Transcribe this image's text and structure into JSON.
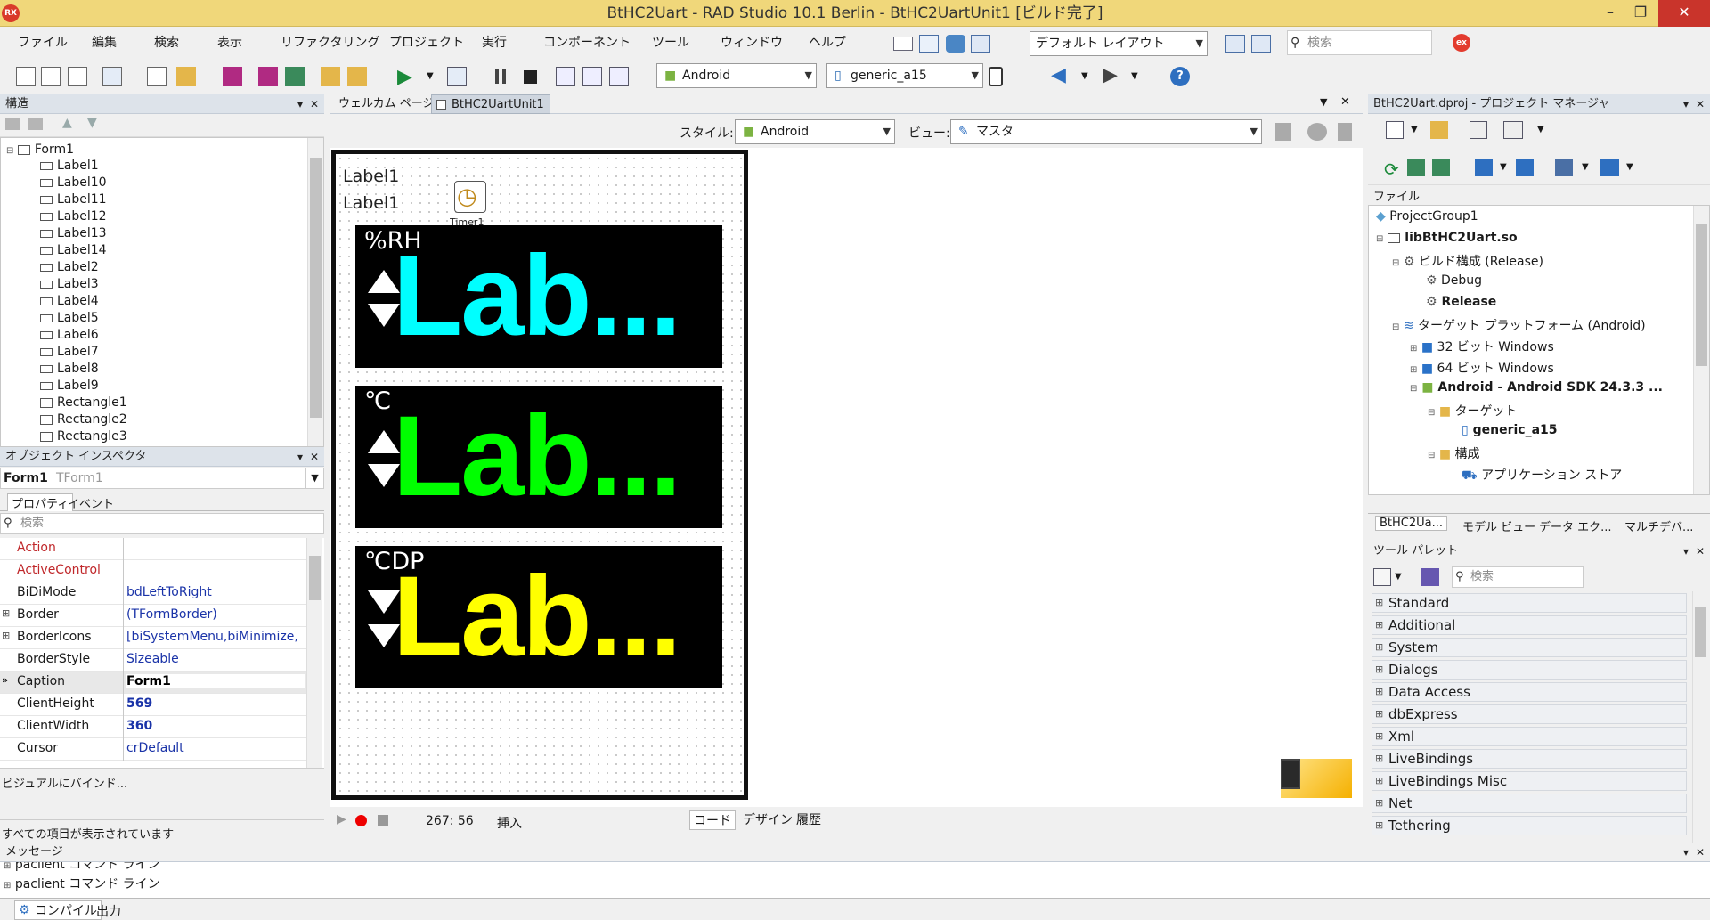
{
  "titlebar": {
    "logo": "RX",
    "title": "BtHC2Uart - RAD Studio 10.1 Berlin - BtHC2UartUnit1 [ビルド完了]"
  },
  "menu": [
    "ファイル",
    "編集",
    "検索",
    "表示",
    "リファクタリング",
    "プロジェクト",
    "実行",
    "コンポーネント",
    "ツール",
    "ウィンドウ",
    "ヘルプ"
  ],
  "toolbar": {
    "layout_combo": "デフォルト レイアウト",
    "search_placeholder": "検索",
    "platform": "Android",
    "device": "generic_a15"
  },
  "structure": {
    "title": "構造",
    "root": "Form1",
    "items": [
      "Label1",
      "Label10",
      "Label11",
      "Label12",
      "Label13",
      "Label14",
      "Label2",
      "Label3",
      "Label4",
      "Label5",
      "Label6",
      "Label7",
      "Label8",
      "Label9"
    ],
    "rects": [
      "Rectangle1",
      "Rectangle2",
      "Rectangle3"
    ]
  },
  "inspector": {
    "title": "オブジェクト インスペクタ",
    "object": "Form1",
    "object_type": "TForm1",
    "tab_props": "プロパティ",
    "tab_events": "イベント",
    "search_placeholder": "検索",
    "props": [
      {
        "name": "Action",
        "value": "",
        "red": true
      },
      {
        "name": "ActiveControl",
        "value": "",
        "red": true
      },
      {
        "name": "BiDiMode",
        "value": "bdLeftToRight"
      },
      {
        "name": "Border",
        "value": "(TFormBorder)",
        "exp": true
      },
      {
        "name": "BorderIcons",
        "value": "[biSystemMenu,biMinimize,",
        "exp": true
      },
      {
        "name": "BorderStyle",
        "value": "Sizeable"
      },
      {
        "name": "Caption",
        "value": "Form1",
        "selected": true
      },
      {
        "name": "ClientHeight",
        "value": "569",
        "bold": true
      },
      {
        "name": "ClientWidth",
        "value": "360",
        "bold": true
      },
      {
        "name": "Cursor",
        "value": "crDefault"
      }
    ],
    "bind_link": "ビジュアルにバインド...",
    "status": "すべての項目が表示されています"
  },
  "designer": {
    "tab_welcome": "ウェルカム ページ",
    "tab_unit": "BtHC2UartUnit1",
    "style_label": "スタイル:",
    "style_value": "Android",
    "view_label": "ビュー:",
    "view_value": "マスタ",
    "label1": "Label1",
    "label1b": "Label1",
    "timer": "Timer1",
    "panels": [
      {
        "unit": "%RH",
        "text": "Lab...",
        "color": "#00ffff",
        "arrows": "up-down"
      },
      {
        "unit": "℃",
        "text": "Lab...",
        "color": "#00ff00",
        "arrows": "up-down"
      },
      {
        "unit": "℃DP",
        "text": "Lab...",
        "color": "#ffff00",
        "arrows": "down-down"
      }
    ],
    "pos": "267:  56",
    "mode": "挿入",
    "bottom_tabs": [
      "コード",
      "デザイン",
      "履歴"
    ]
  },
  "project": {
    "title": "BtHC2Uart.dproj - プロジェクト マネージャ",
    "files_label": "ファイル",
    "nodes": [
      {
        "text": "ProjectGroup1",
        "indent": 0
      },
      {
        "text": "libBtHC2Uart.so",
        "indent": 1,
        "bold": true
      },
      {
        "text": "ビルド構成 (Release)",
        "indent": 2
      },
      {
        "text": "Debug",
        "indent": 3
      },
      {
        "text": "Release",
        "indent": 3,
        "bold": true
      },
      {
        "text": "ターゲット プラットフォーム (Android)",
        "indent": 2
      },
      {
        "text": "32 ビット Windows",
        "indent": 3
      },
      {
        "text": "64 ビット Windows",
        "indent": 3
      },
      {
        "text": "Android - Android SDK 24.3.3 ...",
        "indent": 3,
        "bold": true
      },
      {
        "text": "ターゲット",
        "indent": 4
      },
      {
        "text": "generic_a15",
        "indent": 5,
        "bold": true
      },
      {
        "text": "構成",
        "indent": 4
      },
      {
        "text": "アプリケーション ストア",
        "indent": 5
      }
    ],
    "tabs": [
      "BtHC2Ua...",
      "モデル ビュー",
      "データ エク...",
      "マルチデバ..."
    ]
  },
  "palette": {
    "title": "ツール パレット",
    "search_placeholder": "検索",
    "items": [
      "Standard",
      "Additional",
      "System",
      "Dialogs",
      "Data Access",
      "dbExpress",
      "Xml",
      "LiveBindings",
      "LiveBindings Misc",
      "Net",
      "Tethering"
    ]
  },
  "messages": {
    "title": "メッセージ",
    "lines": [
      "paclient コマンド ライン",
      "paclient コマンド ライン"
    ],
    "tab_compile": "コンパイル",
    "tab_output": "出力"
  }
}
